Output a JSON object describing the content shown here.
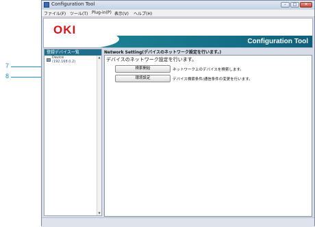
{
  "window": {
    "title": "Configuration Tool",
    "buttons": {
      "minimize": "–",
      "maximize": "□",
      "close": "✕"
    }
  },
  "menubar": {
    "items": [
      "ファイル(F)",
      "ツール(T)",
      "Plug-in(P)",
      "表示(V)",
      "ヘルプ(H)"
    ]
  },
  "brand": {
    "logo": "OKI",
    "app_title": "Configuration Tool",
    "colors": {
      "logo": "#d8121b",
      "band": "#146e86"
    }
  },
  "left_panel": {
    "header": "登録デバイス一覧",
    "device_name": "Device",
    "device_ip": "(192.168.0.2)"
  },
  "main": {
    "section_title": "Network Setting(デバイスのネットワーク設定を行います。)",
    "heading": "デバイスのネットワーク設定を行います。",
    "actions": [
      {
        "label": "検索開始",
        "description": "ネットワーク上のデバイスを検索します。"
      },
      {
        "label": "環境設定",
        "description": "デバイス検索条件/通信条件の変更を行います。"
      }
    ]
  },
  "callouts": [
    "7",
    "8"
  ],
  "icons": {
    "app": "app-icon",
    "device": "printer-icon",
    "scroll_up": "scroll-up-arrow-icon",
    "scroll_down": "scroll-down-arrow-icon"
  }
}
